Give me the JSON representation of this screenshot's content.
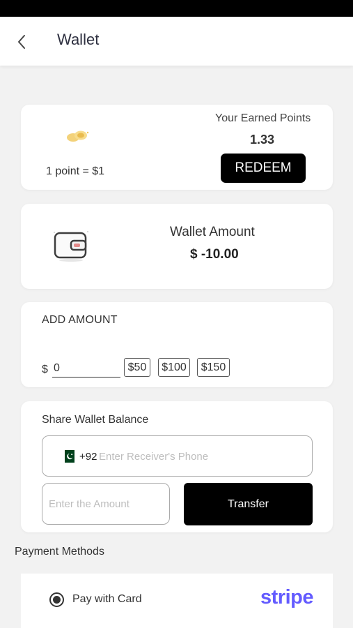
{
  "header": {
    "title": "Wallet"
  },
  "points": {
    "rate": "1 point = $1",
    "earned_label": "Your Earned Points",
    "earned_value": "1.33",
    "redeem_label": "REDEEM"
  },
  "wallet": {
    "title": "Wallet Amount",
    "value": "$ -10.00"
  },
  "add_amount": {
    "title": "ADD AMOUNT",
    "currency": "$",
    "input_value": "0",
    "chips": [
      "$50",
      "$100",
      "$150"
    ]
  },
  "share": {
    "title": "Share Wallet Balance",
    "country_code": "+92",
    "phone_placeholder": "Enter Receiver's Phone",
    "amount_placeholder": "Enter the Amount",
    "transfer_label": "Transfer"
  },
  "payment": {
    "title": "Payment Methods",
    "option_label": "Pay with Card",
    "provider": "stripe",
    "brand_color": "#635bff"
  },
  "icons": [
    "back-arrow-icon",
    "coins-icon",
    "wallet-icon",
    "pakistan-flag-icon",
    "radio-selected-icon"
  ]
}
